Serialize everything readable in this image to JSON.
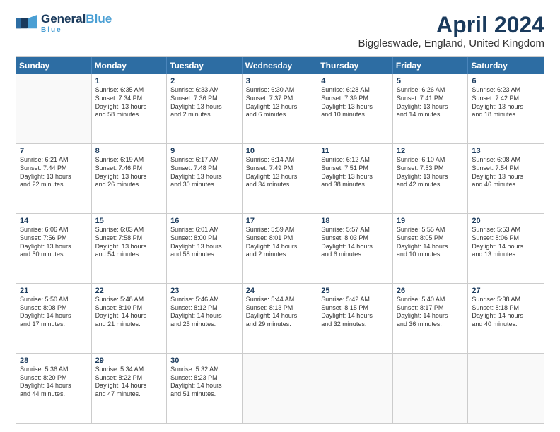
{
  "logo": {
    "general": "General",
    "blue": "Blue",
    "tagline": "Blue"
  },
  "header": {
    "title": "April 2024",
    "location": "Biggleswade, England, United Kingdom"
  },
  "days": [
    "Sunday",
    "Monday",
    "Tuesday",
    "Wednesday",
    "Thursday",
    "Friday",
    "Saturday"
  ],
  "weeks": [
    [
      {
        "day": "",
        "lines": []
      },
      {
        "day": "1",
        "lines": [
          "Sunrise: 6:35 AM",
          "Sunset: 7:34 PM",
          "Daylight: 13 hours",
          "and 58 minutes."
        ]
      },
      {
        "day": "2",
        "lines": [
          "Sunrise: 6:33 AM",
          "Sunset: 7:36 PM",
          "Daylight: 13 hours",
          "and 2 minutes."
        ]
      },
      {
        "day": "3",
        "lines": [
          "Sunrise: 6:30 AM",
          "Sunset: 7:37 PM",
          "Daylight: 13 hours",
          "and 6 minutes."
        ]
      },
      {
        "day": "4",
        "lines": [
          "Sunrise: 6:28 AM",
          "Sunset: 7:39 PM",
          "Daylight: 13 hours",
          "and 10 minutes."
        ]
      },
      {
        "day": "5",
        "lines": [
          "Sunrise: 6:26 AM",
          "Sunset: 7:41 PM",
          "Daylight: 13 hours",
          "and 14 minutes."
        ]
      },
      {
        "day": "6",
        "lines": [
          "Sunrise: 6:23 AM",
          "Sunset: 7:42 PM",
          "Daylight: 13 hours",
          "and 18 minutes."
        ]
      }
    ],
    [
      {
        "day": "7",
        "lines": [
          "Sunrise: 6:21 AM",
          "Sunset: 7:44 PM",
          "Daylight: 13 hours",
          "and 22 minutes."
        ]
      },
      {
        "day": "8",
        "lines": [
          "Sunrise: 6:19 AM",
          "Sunset: 7:46 PM",
          "Daylight: 13 hours",
          "and 26 minutes."
        ]
      },
      {
        "day": "9",
        "lines": [
          "Sunrise: 6:17 AM",
          "Sunset: 7:48 PM",
          "Daylight: 13 hours",
          "and 30 minutes."
        ]
      },
      {
        "day": "10",
        "lines": [
          "Sunrise: 6:14 AM",
          "Sunset: 7:49 PM",
          "Daylight: 13 hours",
          "and 34 minutes."
        ]
      },
      {
        "day": "11",
        "lines": [
          "Sunrise: 6:12 AM",
          "Sunset: 7:51 PM",
          "Daylight: 13 hours",
          "and 38 minutes."
        ]
      },
      {
        "day": "12",
        "lines": [
          "Sunrise: 6:10 AM",
          "Sunset: 7:53 PM",
          "Daylight: 13 hours",
          "and 42 minutes."
        ]
      },
      {
        "day": "13",
        "lines": [
          "Sunrise: 6:08 AM",
          "Sunset: 7:54 PM",
          "Daylight: 13 hours",
          "and 46 minutes."
        ]
      }
    ],
    [
      {
        "day": "14",
        "lines": [
          "Sunrise: 6:06 AM",
          "Sunset: 7:56 PM",
          "Daylight: 13 hours",
          "and 50 minutes."
        ]
      },
      {
        "day": "15",
        "lines": [
          "Sunrise: 6:03 AM",
          "Sunset: 7:58 PM",
          "Daylight: 13 hours",
          "and 54 minutes."
        ]
      },
      {
        "day": "16",
        "lines": [
          "Sunrise: 6:01 AM",
          "Sunset: 8:00 PM",
          "Daylight: 13 hours",
          "and 58 minutes."
        ]
      },
      {
        "day": "17",
        "lines": [
          "Sunrise: 5:59 AM",
          "Sunset: 8:01 PM",
          "Daylight: 14 hours",
          "and 2 minutes."
        ]
      },
      {
        "day": "18",
        "lines": [
          "Sunrise: 5:57 AM",
          "Sunset: 8:03 PM",
          "Daylight: 14 hours",
          "and 6 minutes."
        ]
      },
      {
        "day": "19",
        "lines": [
          "Sunrise: 5:55 AM",
          "Sunset: 8:05 PM",
          "Daylight: 14 hours",
          "and 10 minutes."
        ]
      },
      {
        "day": "20",
        "lines": [
          "Sunrise: 5:53 AM",
          "Sunset: 8:06 PM",
          "Daylight: 14 hours",
          "and 13 minutes."
        ]
      }
    ],
    [
      {
        "day": "21",
        "lines": [
          "Sunrise: 5:50 AM",
          "Sunset: 8:08 PM",
          "Daylight: 14 hours",
          "and 17 minutes."
        ]
      },
      {
        "day": "22",
        "lines": [
          "Sunrise: 5:48 AM",
          "Sunset: 8:10 PM",
          "Daylight: 14 hours",
          "and 21 minutes."
        ]
      },
      {
        "day": "23",
        "lines": [
          "Sunrise: 5:46 AM",
          "Sunset: 8:12 PM",
          "Daylight: 14 hours",
          "and 25 minutes."
        ]
      },
      {
        "day": "24",
        "lines": [
          "Sunrise: 5:44 AM",
          "Sunset: 8:13 PM",
          "Daylight: 14 hours",
          "and 29 minutes."
        ]
      },
      {
        "day": "25",
        "lines": [
          "Sunrise: 5:42 AM",
          "Sunset: 8:15 PM",
          "Daylight: 14 hours",
          "and 32 minutes."
        ]
      },
      {
        "day": "26",
        "lines": [
          "Sunrise: 5:40 AM",
          "Sunset: 8:17 PM",
          "Daylight: 14 hours",
          "and 36 minutes."
        ]
      },
      {
        "day": "27",
        "lines": [
          "Sunrise: 5:38 AM",
          "Sunset: 8:18 PM",
          "Daylight: 14 hours",
          "and 40 minutes."
        ]
      }
    ],
    [
      {
        "day": "28",
        "lines": [
          "Sunrise: 5:36 AM",
          "Sunset: 8:20 PM",
          "Daylight: 14 hours",
          "and 44 minutes."
        ]
      },
      {
        "day": "29",
        "lines": [
          "Sunrise: 5:34 AM",
          "Sunset: 8:22 PM",
          "Daylight: 14 hours",
          "and 47 minutes."
        ]
      },
      {
        "day": "30",
        "lines": [
          "Sunrise: 5:32 AM",
          "Sunset: 8:23 PM",
          "Daylight: 14 hours",
          "and 51 minutes."
        ]
      },
      {
        "day": "",
        "lines": []
      },
      {
        "day": "",
        "lines": []
      },
      {
        "day": "",
        "lines": []
      },
      {
        "day": "",
        "lines": []
      }
    ]
  ]
}
